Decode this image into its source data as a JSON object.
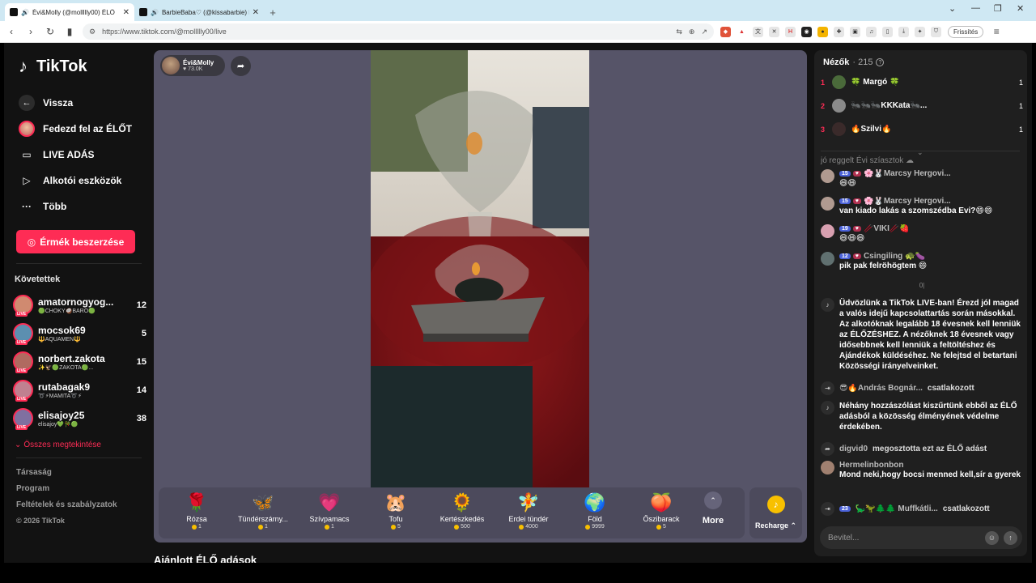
{
  "browser": {
    "tabs": [
      {
        "title": "Évi&Molly (@mollllly00) ÉLŐ",
        "active": true
      },
      {
        "title": "BarbieBaba♡ (@kissabarbie) ÉLŐ",
        "active": false
      }
    ],
    "new_tab": "+",
    "url": "https://www.tiktok.com/@mollllly00/live",
    "refresh_label": "Frissítés"
  },
  "sidebar": {
    "logo": "TikTok",
    "nav": [
      {
        "label": "Vissza",
        "icon": "back-arrow-icon"
      },
      {
        "label": "Fedezd fel az ÉLŐT",
        "icon": "avatar-icon"
      },
      {
        "label": "LIVE ADÁS",
        "icon": "camera-icon"
      },
      {
        "label": "Alkotói eszközök",
        "icon": "creator-tools-icon"
      },
      {
        "label": "Több",
        "icon": "more-dots-icon"
      }
    ],
    "coins_button": "Érmék beszerzése",
    "following_title": "Követettek",
    "following": [
      {
        "name": "amatornogyog...",
        "sub": "🟢CHOKY🥥BARO🟢",
        "count": "12",
        "color": "#d08a70"
      },
      {
        "name": "mocsok69",
        "sub": "🔱AQUAMEN🔱",
        "count": "5",
        "color": "#5c8fb0"
      },
      {
        "name": "norbert.zakota",
        "sub": "✨🦅🟢ZAKOTA🟢...",
        "count": "15",
        "color": "#b06a60"
      },
      {
        "name": "rutabagak9",
        "sub": "➰⚡MAMITA➰⚡",
        "count": "14",
        "color": "#c08090"
      },
      {
        "name": "elisajoy25",
        "sub": "elisajoy💚🎋🟢",
        "count": "38",
        "color": "#8070a0"
      }
    ],
    "see_all": "Összes megtekintése",
    "footer": [
      "Társaság",
      "Program",
      "Feltételek és szabályzatok"
    ],
    "copyright": "© 2026 TikTok"
  },
  "player": {
    "host_name": "Évi&Molly",
    "host_likes": "73.0K",
    "gifts": [
      {
        "name": "Rózsa",
        "price": "1",
        "icon": "🌹"
      },
      {
        "name": "Tündérszárny...",
        "price": "1",
        "icon": "🦋"
      },
      {
        "name": "Szívpamacs",
        "price": "1",
        "icon": "💗"
      },
      {
        "name": "Tofu",
        "price": "5",
        "icon": "🐹"
      },
      {
        "name": "Kertészkedés",
        "price": "500",
        "icon": "🌻"
      },
      {
        "name": "Erdei tündér",
        "price": "4000",
        "icon": "🧚"
      },
      {
        "name": "Föld",
        "price": "9999",
        "icon": "🌍"
      },
      {
        "name": "Őszibarack",
        "price": "5",
        "icon": "🍑"
      }
    ],
    "more_label": "More",
    "recharge_label": "Recharge",
    "recommended_title": "Ajánlott ÉLŐ adások"
  },
  "chat": {
    "viewers_label": "Nézők",
    "viewers_count": "· 215",
    "top_viewers": [
      {
        "rank": "1",
        "name": "🍀 Margó 🍀",
        "score": "1",
        "color": "#4a6a3a"
      },
      {
        "rank": "2",
        "name": "🐜🐜🐜KKKata🐜...",
        "score": "1",
        "color": "#8a8a8a"
      },
      {
        "rank": "3",
        "name": "🔥Szilvi🔥",
        "score": "1",
        "color": "#3a2a2a"
      }
    ],
    "faded_line": "jó reggelt Évi szíasztok ☁",
    "messages": [
      {
        "badge": "15",
        "name": "🌸🐰Marcsy Hergovi...",
        "text": "😄😄",
        "color": "#b09a90"
      },
      {
        "badge": "15",
        "name": "🌸🐰Marcsy Hergovi...",
        "text": "van kiado lakás a szomszédba Evi?😄😄",
        "color": "#b09a90"
      },
      {
        "badge": "19",
        "name": "🥢VIKI🥢🍓",
        "text": "😄😄😄",
        "color": "#d8a0b0"
      },
      {
        "badge": "12",
        "name": "Csingiling 🐢🍆",
        "text": "pik pak felröhögtem 😄",
        "color": "#607070"
      }
    ],
    "small_mark": "0|",
    "system_welcome": "Üdvözlünk a TikTok LIVE-ban! Érezd jól magad a valós idejű kapcsolattartás során másokkal. Az alkotóknak legalább 18 évesnek kell lenniük az ÉLŐZÉSHEZ. A nézőknek 18 évesnek vagy idősebbnek kell lenniük a feltöltéshez és Ajándékok küldéséhez. Ne felejtsd el betartani Közösségi irányelveinket.",
    "join1_name": "😎🔥András Bognár...",
    "join1_action": "csatlakozott",
    "system_filter": "Néhány hozzászólást kiszűrtünk ebből az ÉLŐ adásból a közösség élményének védelme érdekében.",
    "share_name": "digvid0",
    "share_action": "megosztotta ezt az ÉLŐ adást",
    "last_msg_name": "Hermelinbonbon",
    "last_msg_text": "Mond neki,hogy bocsi menned kell,sír a gyerek",
    "join2_badge": "23",
    "join2_name": "🦕🦖🌲🌲 Muffkátli...",
    "join2_action": "csatlakozott",
    "input_placeholder": "Bevitel..."
  }
}
